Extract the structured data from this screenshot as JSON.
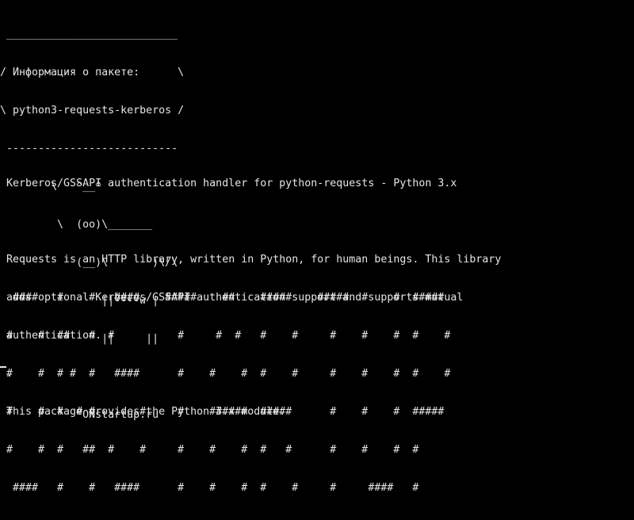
{
  "terminal": {
    "cowsay_lines": [
      " ___________________________",
      "/ Информация о пакете:      \\",
      "\\ python3-requests-kerberos /",
      " ---------------------------",
      "        \\   ^__^",
      "         \\  (oo)\\_______",
      "            (__)\\       )\\/\\",
      "                ||----w |",
      "                ||     ||",
      "",
      "             ONstartup.ru"
    ],
    "description_lines": [
      " Kerberos/GSSAPI authentication handler for python-requests - Python 3.x",
      "",
      " Requests is an HTTP library, written in Python, for human beings. This library",
      " adds optional Kerberos/GSSAPI authentication support and supports mutual",
      " authentication.",
      " .",
      " This package provides the Python 3.x module."
    ],
    "banner_lines": [
      "  ####   #    #   ####    #####    ##    #####    #####  #    #  #####",
      " #    #  ##   #  #          #     #  #   #    #     #    #    #  #    #",
      " #    #  # #  #   ####      #    #    #  #    #     #    #    #  #    #",
      " #    #  #  # #       #     #    ######  #####      #    #    #  #####",
      " #    #  #   ##  #    #     #    #    #  #   #      #    #    #  #",
      "  ####   #    #   ####      #    #    #  #    #     #     ####   #"
    ],
    "colors": {
      "background": "#000000",
      "foreground": "#e6e6e6"
    }
  }
}
